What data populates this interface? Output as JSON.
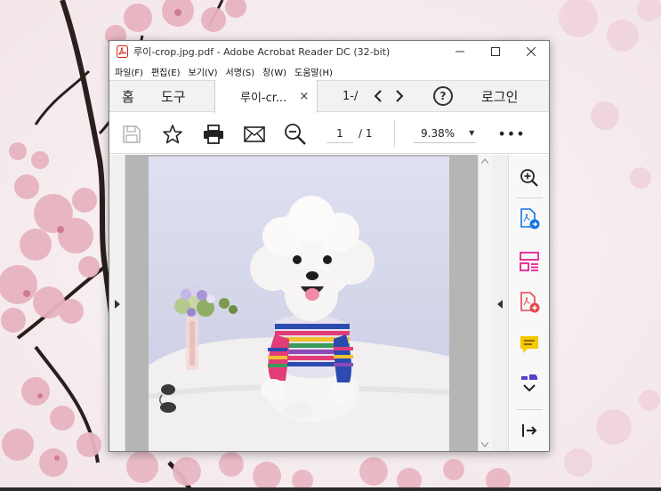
{
  "window": {
    "title": "루이-crop.jpg.pdf - Adobe Acrobat Reader DC (32-bit)",
    "minimize": "—",
    "maximize": "☐",
    "close": "✕"
  },
  "menu": {
    "items": [
      {
        "label": "파일(F)"
      },
      {
        "label": "편집(E)"
      },
      {
        "label": "보기(V)"
      },
      {
        "label": "서명(S)"
      },
      {
        "label": "창(W)"
      },
      {
        "label": "도움말(H)"
      }
    ]
  },
  "tabs": {
    "home": "홈",
    "tools": "도구",
    "active_doc": "루이-cr...",
    "active_close": "×",
    "second_doc": "1-/",
    "help": "?",
    "login": "로그인"
  },
  "toolbar": {
    "page_current": "1",
    "page_total": "/ 1",
    "zoom": "9.38%",
    "zoom_caret": "▼",
    "more": "•••"
  },
  "icons": {
    "save": "save-icon",
    "bookmark": "star-icon",
    "print": "print-icon",
    "email": "mail-icon",
    "zoom_out": "zoom-out-icon",
    "left_arrow": "chevron-left-icon",
    "right_arrow": "chevron-right-icon"
  },
  "colors": {
    "acrobat_red": "#d9261c",
    "export_blue": "#1473e6",
    "organize_pink": "#e5208c",
    "create_red": "#e34850",
    "comment_yellow": "#f7c800"
  }
}
